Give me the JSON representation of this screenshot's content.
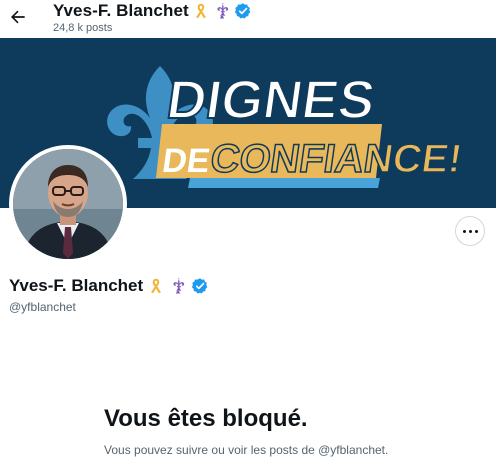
{
  "header": {
    "title": "Yves-F. Blanchet",
    "post_count": "24,8 k posts"
  },
  "banner": {
    "line1": "DIGNES",
    "line2a": "DE",
    "line2b": "CONFIANCE!"
  },
  "profile": {
    "name": "Yves-F. Blanchet",
    "handle": "@yfblanchet"
  },
  "blocked": {
    "title": "Vous êtes bloqué.",
    "message": "Vous pouvez suivre ou voir les posts de @yfblanchet."
  },
  "colors": {
    "banner_bg": "#0e3a5c",
    "banner_yellow": "#e9b85a",
    "banner_blue": "#4aa3d8",
    "verified_blue": "#1d9bf0"
  },
  "icons": [
    "back-arrow-icon",
    "yellow-ribbon-icon",
    "fleur-de-lis-icon",
    "verified-badge-icon",
    "more-icon"
  ]
}
